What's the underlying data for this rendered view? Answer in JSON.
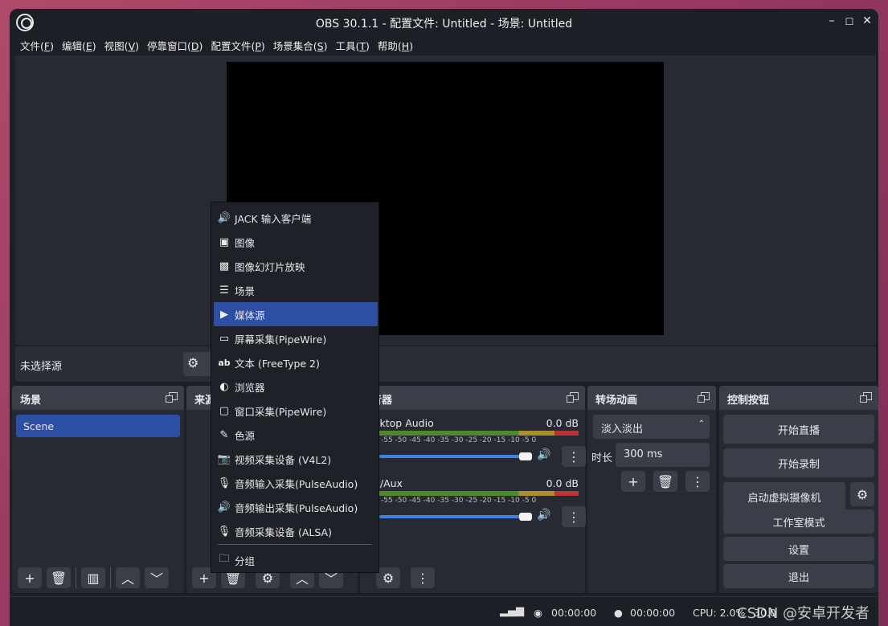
{
  "window": {
    "title": "OBS 30.1.1 - 配置文件: Untitled - 场景: Untitled"
  },
  "menubar": [
    {
      "label": "文件(",
      "key": "F",
      "end": ")"
    },
    {
      "label": "编辑(",
      "key": "E",
      "end": ")"
    },
    {
      "label": "视图(",
      "key": "V",
      "end": ")"
    },
    {
      "label": "停靠窗口(",
      "key": "D",
      "end": ")"
    },
    {
      "label": "配置文件(",
      "key": "P",
      "end": ")"
    },
    {
      "label": "场景集合(",
      "key": "S",
      "end": ")"
    },
    {
      "label": "工具(",
      "key": "T",
      "end": ")"
    },
    {
      "label": "帮助(",
      "key": "H",
      "end": ")"
    }
  ],
  "no_source": {
    "label": "未选择源",
    "prop_partial": "i"
  },
  "docks": {
    "scenes": {
      "title": "场景",
      "items": [
        "Scene"
      ]
    },
    "sources": {
      "title": "来源"
    },
    "mixer": {
      "title": "音器",
      "channels": [
        {
          "name": "sktop Audio",
          "db": "0.0 dB"
        },
        {
          "name": "c/Aux",
          "db": "0.0 dB"
        }
      ],
      "ticks": "-55 -50 -45 -40 -35 -30 -25 -20 -15 -10 -5 0"
    },
    "transitions": {
      "title": "转场动画",
      "type": "淡入淡出",
      "duration_label": "时长",
      "duration": "300 ms"
    },
    "controls": {
      "title": "控制按钮",
      "buttons": [
        "开始直播",
        "开始录制",
        "启动虚拟摄像机",
        "工作室模式",
        "设置",
        "退出"
      ]
    }
  },
  "context_menu": [
    {
      "label": "JACK 输入客户端",
      "icon": "speaker-icon"
    },
    {
      "label": "图像",
      "icon": "image-icon"
    },
    {
      "label": "图像幻灯片放映",
      "icon": "slideshow-icon"
    },
    {
      "label": "场景",
      "icon": "list-icon"
    },
    {
      "label": "媒体源",
      "icon": "play-icon",
      "selected": true
    },
    {
      "label": "屏幕采集(PipeWire)",
      "icon": "monitor-icon"
    },
    {
      "label": "文本 (FreeType 2)",
      "icon": "text-icon"
    },
    {
      "label": "浏览器",
      "icon": "globe-icon"
    },
    {
      "label": "窗口采集(PipeWire)",
      "icon": "window-icon"
    },
    {
      "label": "色源",
      "icon": "brush-icon"
    },
    {
      "label": "视频采集设备 (V4L2)",
      "icon": "camera-icon"
    },
    {
      "label": "音频输入采集(PulseAudio)",
      "icon": "mic-icon"
    },
    {
      "label": "音频输出采集(PulseAudio)",
      "icon": "speaker-icon"
    },
    {
      "label": "音频采集设备 (ALSA)",
      "icon": "mic-icon"
    },
    {
      "label": "分组",
      "icon": "folder-icon"
    }
  ],
  "status": {
    "stream_time": "00:00:00",
    "rec_time": "00:00:00",
    "cpu": "CPU: 2.0%",
    "partial": "30.0"
  },
  "watermark": "CSDN @安卓开发者",
  "colors": {
    "accent": "#2c4fa3",
    "panel": "#272a33",
    "header": "#3a3e49",
    "window_bg": "#1d1f26"
  }
}
